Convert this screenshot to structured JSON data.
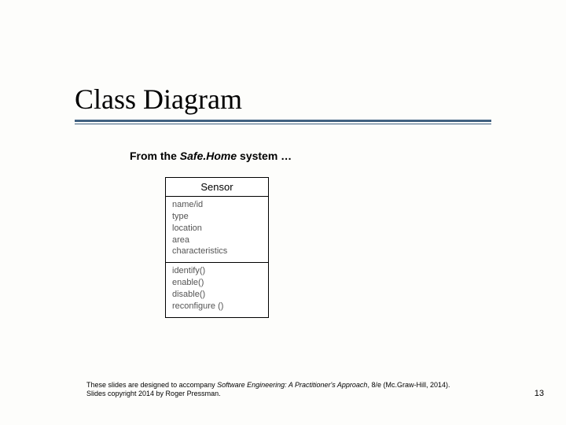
{
  "title": "Class Diagram",
  "subtitle_pre": "From the ",
  "subtitle_ital": "Safe.Home",
  "subtitle_post": " system …",
  "uml": {
    "class_name": "Sensor",
    "attributes": [
      "name/id",
      "type",
      "location",
      "area",
      "characteristics"
    ],
    "operations": [
      "identify()",
      "enable()",
      "disable()",
      "reconfigure ()"
    ]
  },
  "footer": {
    "pre": "These slides are designed to accompany ",
    "book": "Software Engineering: A Practitioner's Approach",
    "post": ", 8/e (Mc.Graw-Hill, 2014). Slides copyright 2014 by Roger Pressman."
  },
  "page_number": "13"
}
